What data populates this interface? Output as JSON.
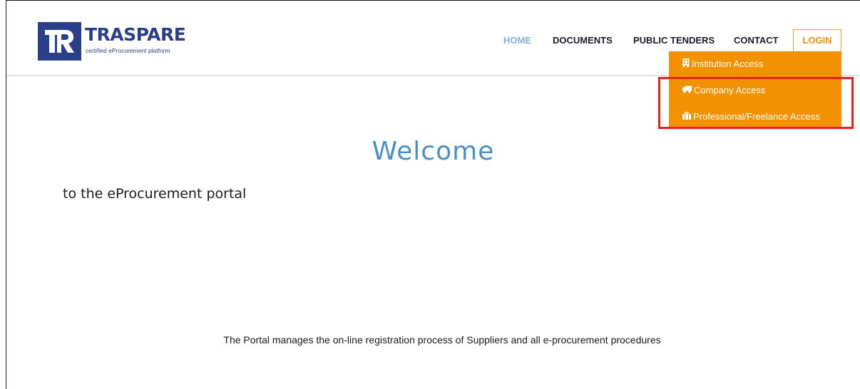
{
  "brand": {
    "name": "TRASPARE",
    "tagline": "certified eProcurement platform",
    "color": "#2a3f8a"
  },
  "nav": {
    "items": [
      {
        "label": "HOME",
        "active": true
      },
      {
        "label": "DOCUMENTS",
        "active": false
      },
      {
        "label": "PUBLIC TENDERS",
        "active": false
      },
      {
        "label": "CONTACT",
        "active": false
      }
    ],
    "login_label": "LOGIN"
  },
  "login_menu": {
    "items": [
      {
        "label": "Institution Access",
        "icon": "building-icon"
      },
      {
        "label": "Company Access",
        "icon": "truck-icon"
      },
      {
        "label": "Professional/Freelance Access",
        "icon": "briefcase-icon"
      }
    ],
    "background": "#f39200",
    "highlight_color": "#e8231a"
  },
  "hero": {
    "title": "Welcome",
    "subtitle": "to the eProcurement portal",
    "description": "The Portal manages the on-line registration process of Suppliers and all e-procurement procedures"
  },
  "colors": {
    "active_nav": "#7fb3d6",
    "welcome": "#4a90c8",
    "accent": "#f39200"
  }
}
